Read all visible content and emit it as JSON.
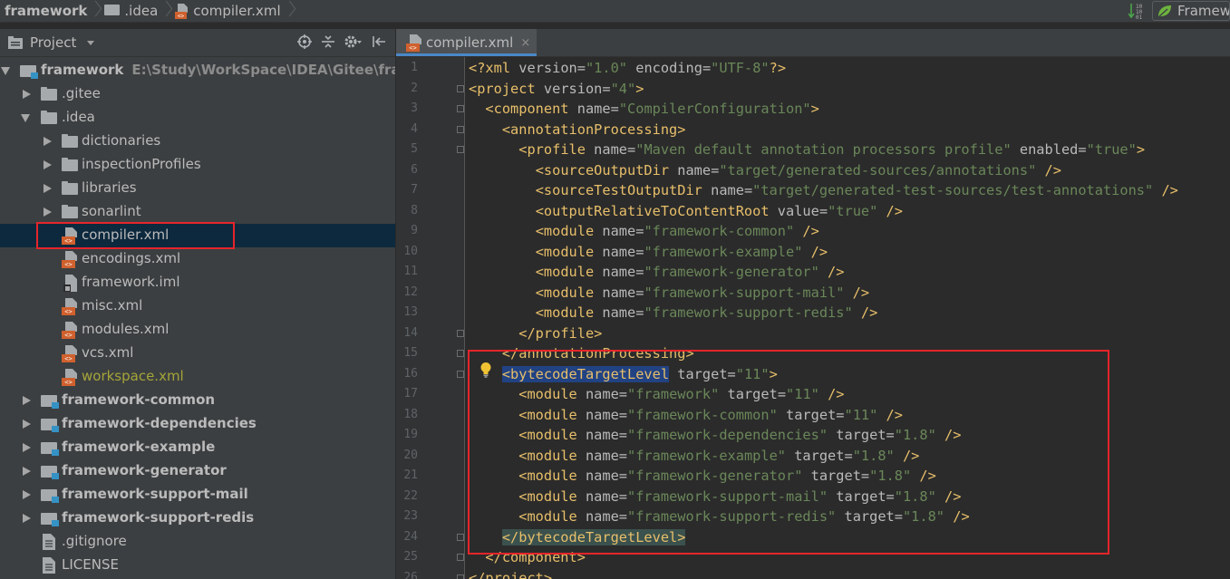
{
  "navbar": {
    "crumbs": [
      "framework",
      ".idea",
      "compiler.xml"
    ],
    "run_config": "Framework"
  },
  "project_panel": {
    "title": "Project",
    "tree": [
      {
        "label": "framework",
        "path": "E:\\Study\\WorkSpace\\IDEA\\Gitee\\framework",
        "type": "module",
        "expanded": true,
        "bold": true
      },
      {
        "label": ".gitee",
        "type": "folder",
        "expanded": false
      },
      {
        "label": ".idea",
        "type": "folder",
        "expanded": true
      },
      {
        "label": "dictionaries",
        "type": "folder",
        "expanded": false
      },
      {
        "label": "inspectionProfiles",
        "type": "folder",
        "expanded": false
      },
      {
        "label": "libraries",
        "type": "folder",
        "expanded": false
      },
      {
        "label": "sonarlint",
        "type": "folder",
        "expanded": false
      },
      {
        "label": "compiler.xml",
        "type": "xml",
        "selected": true
      },
      {
        "label": "encodings.xml",
        "type": "xml"
      },
      {
        "label": "framework.iml",
        "type": "iml"
      },
      {
        "label": "misc.xml",
        "type": "xml"
      },
      {
        "label": "modules.xml",
        "type": "xml"
      },
      {
        "label": "vcs.xml",
        "type": "xml"
      },
      {
        "label": "workspace.xml",
        "type": "xml",
        "color": "#a5a539"
      },
      {
        "label": "framework-common",
        "type": "module",
        "expanded": false,
        "bold": true
      },
      {
        "label": "framework-dependencies",
        "type": "module",
        "expanded": false,
        "bold": true
      },
      {
        "label": "framework-example",
        "type": "module",
        "expanded": false,
        "bold": true
      },
      {
        "label": "framework-generator",
        "type": "module",
        "expanded": false,
        "bold": true
      },
      {
        "label": "framework-support-mail",
        "type": "module",
        "expanded": false,
        "bold": true
      },
      {
        "label": "framework-support-redis",
        "type": "module",
        "expanded": false,
        "bold": true
      },
      {
        "label": ".gitignore",
        "type": "text"
      },
      {
        "label": "LICENSE",
        "type": "text"
      }
    ]
  },
  "editor": {
    "tab": {
      "label": "compiler.xml",
      "close": "×"
    },
    "lines": [
      {
        "n": "1",
        "text": "<?xml version=\"1.0\" encoding=\"UTF-8\"?>"
      },
      {
        "n": "2",
        "text": "<project version=\"4\">"
      },
      {
        "n": "3",
        "text": "  <component name=\"CompilerConfiguration\">"
      },
      {
        "n": "4",
        "text": "    <annotationProcessing>"
      },
      {
        "n": "5",
        "text": "      <profile name=\"Maven default annotation processors profile\" enabled=\"true\">"
      },
      {
        "n": "6",
        "text": "        <sourceOutputDir name=\"target/generated-sources/annotations\" />"
      },
      {
        "n": "7",
        "text": "        <sourceTestOutputDir name=\"target/generated-test-sources/test-annotations\" />"
      },
      {
        "n": "8",
        "text": "        <outputRelativeToContentRoot value=\"true\" />"
      },
      {
        "n": "9",
        "text": "        <module name=\"framework-common\" />"
      },
      {
        "n": "10",
        "text": "        <module name=\"framework-example\" />"
      },
      {
        "n": "11",
        "text": "        <module name=\"framework-generator\" />"
      },
      {
        "n": "12",
        "text": "        <module name=\"framework-support-mail\" />"
      },
      {
        "n": "13",
        "text": "        <module name=\"framework-support-redis\" />"
      },
      {
        "n": "14",
        "text": "      </profile>"
      },
      {
        "n": "15",
        "text": "    </annotationProcessing>"
      },
      {
        "n": "16",
        "text": "    <bytecodeTargetLevel target=\"11\">"
      },
      {
        "n": "17",
        "text": "      <module name=\"framework\" target=\"11\" />"
      },
      {
        "n": "18",
        "text": "      <module name=\"framework-common\" target=\"11\" />"
      },
      {
        "n": "19",
        "text": "      <module name=\"framework-dependencies\" target=\"1.8\" />"
      },
      {
        "n": "20",
        "text": "      <module name=\"framework-example\" target=\"1.8\" />"
      },
      {
        "n": "21",
        "text": "      <module name=\"framework-generator\" target=\"1.8\" />"
      },
      {
        "n": "22",
        "text": "      <module name=\"framework-support-mail\" target=\"1.8\" />"
      },
      {
        "n": "23",
        "text": "      <module name=\"framework-support-redis\" target=\"1.8\" />"
      },
      {
        "n": "24",
        "text": "    </bytecodeTargetLevel>"
      },
      {
        "n": "25",
        "text": "  </component>"
      },
      {
        "n": "26",
        "text": "</project>"
      }
    ]
  },
  "colors": {
    "tag": "#e8bf6a",
    "attr": "#bababa",
    "value": "#6a8759",
    "selection": "#214283",
    "annotation_box": "#e5252a"
  },
  "icons": [
    "folder-icon",
    "module-icon",
    "xml-file-icon",
    "iml-file-icon",
    "text-file-icon",
    "lightbulb-icon",
    "locate-icon",
    "collapse-icon",
    "gear-icon",
    "hide-icon",
    "close-icon"
  ]
}
